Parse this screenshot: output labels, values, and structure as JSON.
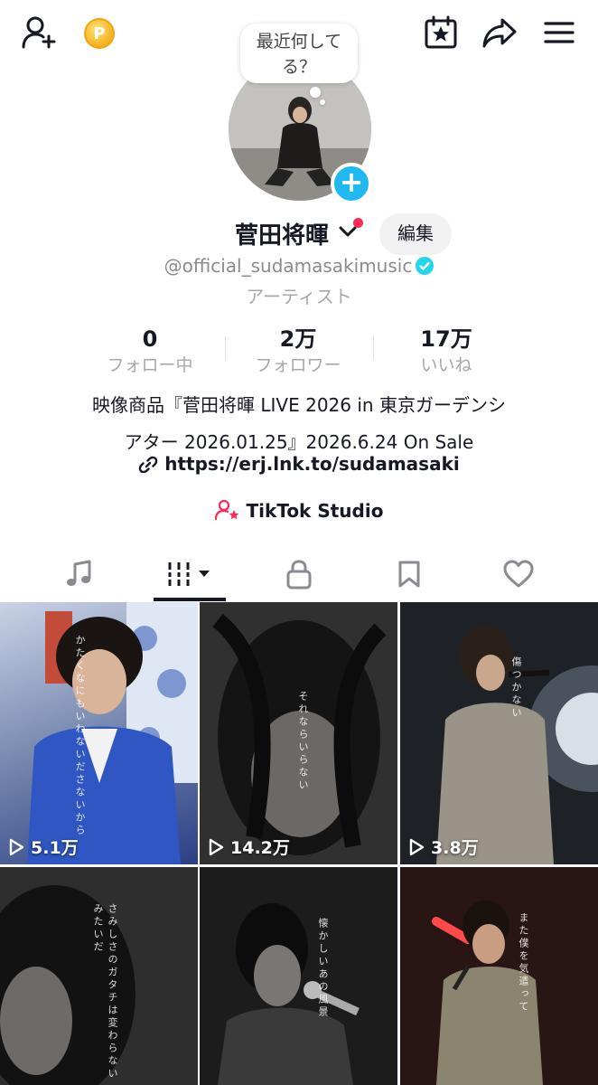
{
  "header": {
    "add_friend_icon": "person-add-icon",
    "coin_icon": "p-coin-icon",
    "coin_letter": "P",
    "calendar_icon": "calendar-star-icon",
    "share_icon": "share-arrow-icon",
    "menu_icon": "hamburger-menu-icon"
  },
  "profile": {
    "bubble_line1": "最近何して",
    "bubble_line2": "る？",
    "name": "菅田将暉",
    "edit_label": "編集",
    "handle": "@official_sudamasakimusic",
    "category": "アーティスト"
  },
  "stats": [
    {
      "value": "0",
      "label": "フォロー中"
    },
    {
      "value": "2万",
      "label": "フォロワー"
    },
    {
      "value": "17万",
      "label": "いいね"
    }
  ],
  "bio": {
    "line1": "映像商品『菅田将暉 LIVE 2026 in 東京ガーデンシ",
    "line2": "アター 2026.01.25』2026.6.24 On Sale",
    "link": "https://erj.lnk.to/sudamasaki",
    "studio": "TikTok Studio"
  },
  "tabs": [
    "music-note-icon",
    "videos-grid-icon",
    "lock-icon",
    "bookmark-icon",
    "heart-icon"
  ],
  "videos": [
    {
      "views": "5.1万",
      "caption": "かたくなにもいわないださないから"
    },
    {
      "views": "14.2万",
      "caption": "それならいらない"
    },
    {
      "views": "3.8万",
      "caption": "傷つかない"
    },
    {
      "views": "",
      "caption": "さみしさのガタチは変わらないみたいだ"
    },
    {
      "views": "",
      "caption": "懐かしいあの風景"
    },
    {
      "views": "",
      "caption": "また僕を気遣って"
    }
  ],
  "colors": {
    "accent_red": "#fe2c55",
    "plus_blue": "#20b8f0",
    "verified": "#20d5ec",
    "text": "#161823",
    "muted": "#a7a8ad"
  }
}
